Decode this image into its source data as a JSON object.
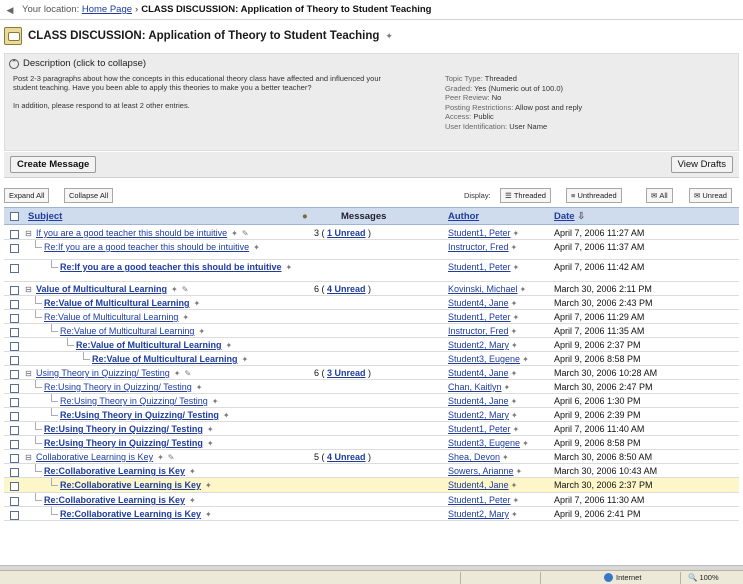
{
  "breadcrumb": {
    "prefix": "Your location:",
    "home": "Home Page",
    "separator": "›",
    "current": "CLASS DISCUSSION: Application of Theory to Student Teaching"
  },
  "title": "CLASS DISCUSSION: Application of Theory to Student Teaching",
  "description": {
    "toggle_label": "Description (click to collapse)",
    "paragraph1": "Post 2-3 paragraphs about how the concepts in this educational theory class have affected and influenced your student teaching. Have you been able to apply this theories to make you a better teacher?",
    "paragraph2": "In addition, please respond to at least 2 other entries.",
    "meta": [
      {
        "label": "Topic Type:",
        "value": "Threaded"
      },
      {
        "label": "Graded:",
        "value": "Yes (Numeric out of 100.0)"
      },
      {
        "label": "Peer Review:",
        "value": "No"
      },
      {
        "label": "Posting Restrictions:",
        "value": "Allow post and reply"
      },
      {
        "label": "Access:",
        "value": "Public"
      },
      {
        "label": "User Identification:",
        "value": "User Name"
      }
    ]
  },
  "toolbar": {
    "create_message": "Create Message",
    "view_drafts": "View Drafts"
  },
  "display_bar": {
    "expand_all": "Expand All",
    "collapse_all": "Collapse All",
    "display_label": "Display:",
    "threaded": "Threaded",
    "unthreaded": "Unthreaded",
    "all": "All",
    "unread": "Unread"
  },
  "columns": {
    "subject": "Subject",
    "messages": "Messages",
    "author": "Author",
    "date": "Date"
  },
  "rows": [
    {
      "level": 0,
      "expander": "⊟",
      "subject": "If you are a good teacher this should be intuitive",
      "bold": false,
      "attach": true,
      "messages": "3",
      "unread": "1 Unread",
      "author": "Student1, Peter",
      "date": "April 7, 2006 11:27 AM",
      "height": 14
    },
    {
      "level": 1,
      "subject": "Re:If you are a good teacher this should be intuitive",
      "bold": false,
      "attach": false,
      "author": "Instructor, Fred",
      "date": "April 7, 2006 11:37 AM",
      "height": 20
    },
    {
      "level": 2,
      "subject": "Re:If you are a good teacher this should be intuitive",
      "bold": true,
      "attach": false,
      "author": "Student1, Peter",
      "date": "April 7, 2006 11:42 AM",
      "height": 22
    },
    {
      "level": 0,
      "expander": "⊟",
      "subject": "Value of Multicultural Learning",
      "bold": true,
      "attach": true,
      "messages": "6",
      "unread": "4 Unread",
      "author": "Kovinski, Michael",
      "date": "March 30, 2006 2:11 PM",
      "height": 14
    },
    {
      "level": 1,
      "subject": "Re:Value of Multicultural Learning",
      "bold": true,
      "attach": false,
      "author": "Student4, Jane",
      "date": "March 30, 2006 2:43 PM",
      "height": 14
    },
    {
      "level": 1,
      "subject": "Re:Value of Multicultural Learning",
      "bold": false,
      "attach": false,
      "author": "Student1, Peter",
      "date": "April 7, 2006 11:29 AM",
      "height": 14
    },
    {
      "level": 2,
      "subject": "Re:Value of Multicultural Learning",
      "bold": false,
      "attach": false,
      "author": "Instructor, Fred",
      "date": "April 7, 2006 11:35 AM",
      "height": 14
    },
    {
      "level": 3,
      "subject": "Re:Value of Multicultural Learning",
      "bold": true,
      "attach": false,
      "author": "Student2, Mary",
      "date": "April 9, 2006 2:37 PM",
      "height": 14
    },
    {
      "level": 4,
      "subject": "Re:Value of Multicultural Learning",
      "bold": true,
      "attach": false,
      "author": "Student3, Eugene",
      "date": "April 9, 2006 8:58 PM",
      "height": 14
    },
    {
      "level": 0,
      "expander": "⊟",
      "subject": "Using Theory in Quizzing/ Testing",
      "bold": false,
      "attach": true,
      "messages": "6",
      "unread": "3 Unread",
      "author": "Student4, Jane",
      "date": "March 30, 2006 10:28 AM",
      "height": 14
    },
    {
      "level": 1,
      "subject": "Re:Using Theory in Quizzing/ Testing",
      "bold": false,
      "attach": false,
      "author": "Chan, Kaitlyn",
      "date": "March 30, 2006 2:47 PM",
      "height": 14
    },
    {
      "level": 2,
      "subject": "Re:Using Theory in Quizzing/ Testing",
      "bold": false,
      "attach": false,
      "author": "Student4, Jane",
      "date": "April 6, 2006 1:30 PM",
      "height": 14
    },
    {
      "level": 2,
      "subject": "Re:Using Theory in Quizzing/ Testing",
      "bold": true,
      "attach": false,
      "author": "Student2, Mary",
      "date": "April 9, 2006 2:39 PM",
      "height": 14
    },
    {
      "level": 1,
      "subject": "Re:Using Theory in Quizzing/ Testing",
      "bold": true,
      "attach": false,
      "author": "Student1, Peter",
      "date": "April 7, 2006 11:40 AM",
      "height": 14
    },
    {
      "level": 1,
      "subject": "Re:Using Theory in Quizzing/ Testing",
      "bold": true,
      "attach": false,
      "author": "Student3, Eugene",
      "date": "April 9, 2006 8:58 PM",
      "height": 14
    },
    {
      "level": 0,
      "expander": "⊟",
      "subject": "Collaborative Learning is Key",
      "bold": false,
      "attach": true,
      "messages": "5",
      "unread": "4 Unread",
      "author": "Shea, Devon",
      "date": "March 30, 2006 8:50 AM",
      "height": 14
    },
    {
      "level": 1,
      "subject": "Re:Collaborative Learning is Key",
      "bold": true,
      "attach": false,
      "author": "Sowers, Arianne",
      "date": "March 30, 2006 10:43 AM",
      "height": 14
    },
    {
      "level": 2,
      "subject": "Re:Collaborative Learning is Key",
      "bold": true,
      "attach": false,
      "author": "Student4, Jane",
      "date": "March 30, 2006 2:37 PM",
      "height": 15,
      "highlight": true
    },
    {
      "level": 1,
      "subject": "Re:Collaborative Learning is Key",
      "bold": true,
      "attach": false,
      "author": "Student1, Peter",
      "date": "April 7, 2006 11:30 AM",
      "height": 14
    },
    {
      "level": 2,
      "subject": "Re:Collaborative Learning is Key",
      "bold": true,
      "attach": false,
      "author": "Student2, Mary",
      "date": "April 9, 2006 2:41 PM",
      "height": 14
    }
  ],
  "statusbar": {
    "zone": "Internet",
    "zoom": "100%"
  },
  "colors": {
    "link": "#1f3c9f",
    "header_bg": "#cfdcee",
    "highlight_row": "#fdf6c8"
  }
}
